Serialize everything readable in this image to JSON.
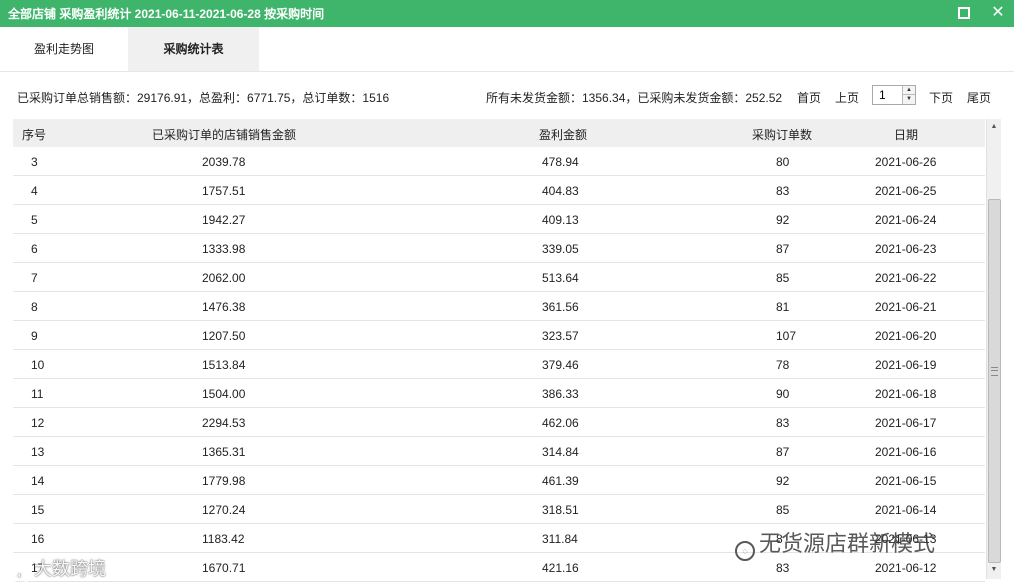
{
  "window": {
    "title": "全部店铺 采购盈利统计 2021-06-11-2021-06-28 按采购时间",
    "close_glyph": "✕"
  },
  "tabs": [
    {
      "label": "盈利走势图"
    },
    {
      "label": "采购统计表"
    }
  ],
  "summary": {
    "left": "已采购订单总销售额：29176.91，总盈利：6771.75，总订单数：1516",
    "right": "所有未发货金额：1356.34，已采购未发货金额：252.52"
  },
  "pager": {
    "first": "首页",
    "prev": "上页",
    "page": "1",
    "next": "下页",
    "last": "尾页"
  },
  "table": {
    "columns": [
      "序号",
      "已采购订单的店铺销售金额",
      "盈利金额",
      "采购订单数",
      "日期"
    ],
    "rows": [
      [
        "3",
        "2039.78",
        "478.94",
        "80",
        "2021-06-26"
      ],
      [
        "4",
        "1757.51",
        "404.83",
        "83",
        "2021-06-25"
      ],
      [
        "5",
        "1942.27",
        "409.13",
        "92",
        "2021-06-24"
      ],
      [
        "6",
        "1333.98",
        "339.05",
        "87",
        "2021-06-23"
      ],
      [
        "7",
        "2062.00",
        "513.64",
        "85",
        "2021-06-22"
      ],
      [
        "8",
        "1476.38",
        "361.56",
        "81",
        "2021-06-21"
      ],
      [
        "9",
        "1207.50",
        "323.57",
        "107",
        "2021-06-20"
      ],
      [
        "10",
        "1513.84",
        "379.46",
        "78",
        "2021-06-19"
      ],
      [
        "11",
        "1504.00",
        "386.33",
        "90",
        "2021-06-18"
      ],
      [
        "12",
        "2294.53",
        "462.06",
        "83",
        "2021-06-17"
      ],
      [
        "13",
        "1365.31",
        "314.84",
        "87",
        "2021-06-16"
      ],
      [
        "14",
        "1779.98",
        "461.39",
        "92",
        "2021-06-15"
      ],
      [
        "15",
        "1270.24",
        "318.51",
        "85",
        "2021-06-14"
      ],
      [
        "16",
        "1183.42",
        "311.84",
        "8",
        "2021-06-13"
      ],
      [
        "17",
        "1670.71",
        "421.16",
        "83",
        "2021-06-12"
      ]
    ]
  },
  "watermarks": {
    "right": "无货源店群新模式",
    "left": "大数跨境"
  },
  "colors": {
    "titlebar": "#3fb56c",
    "header_bg": "#efefef"
  }
}
